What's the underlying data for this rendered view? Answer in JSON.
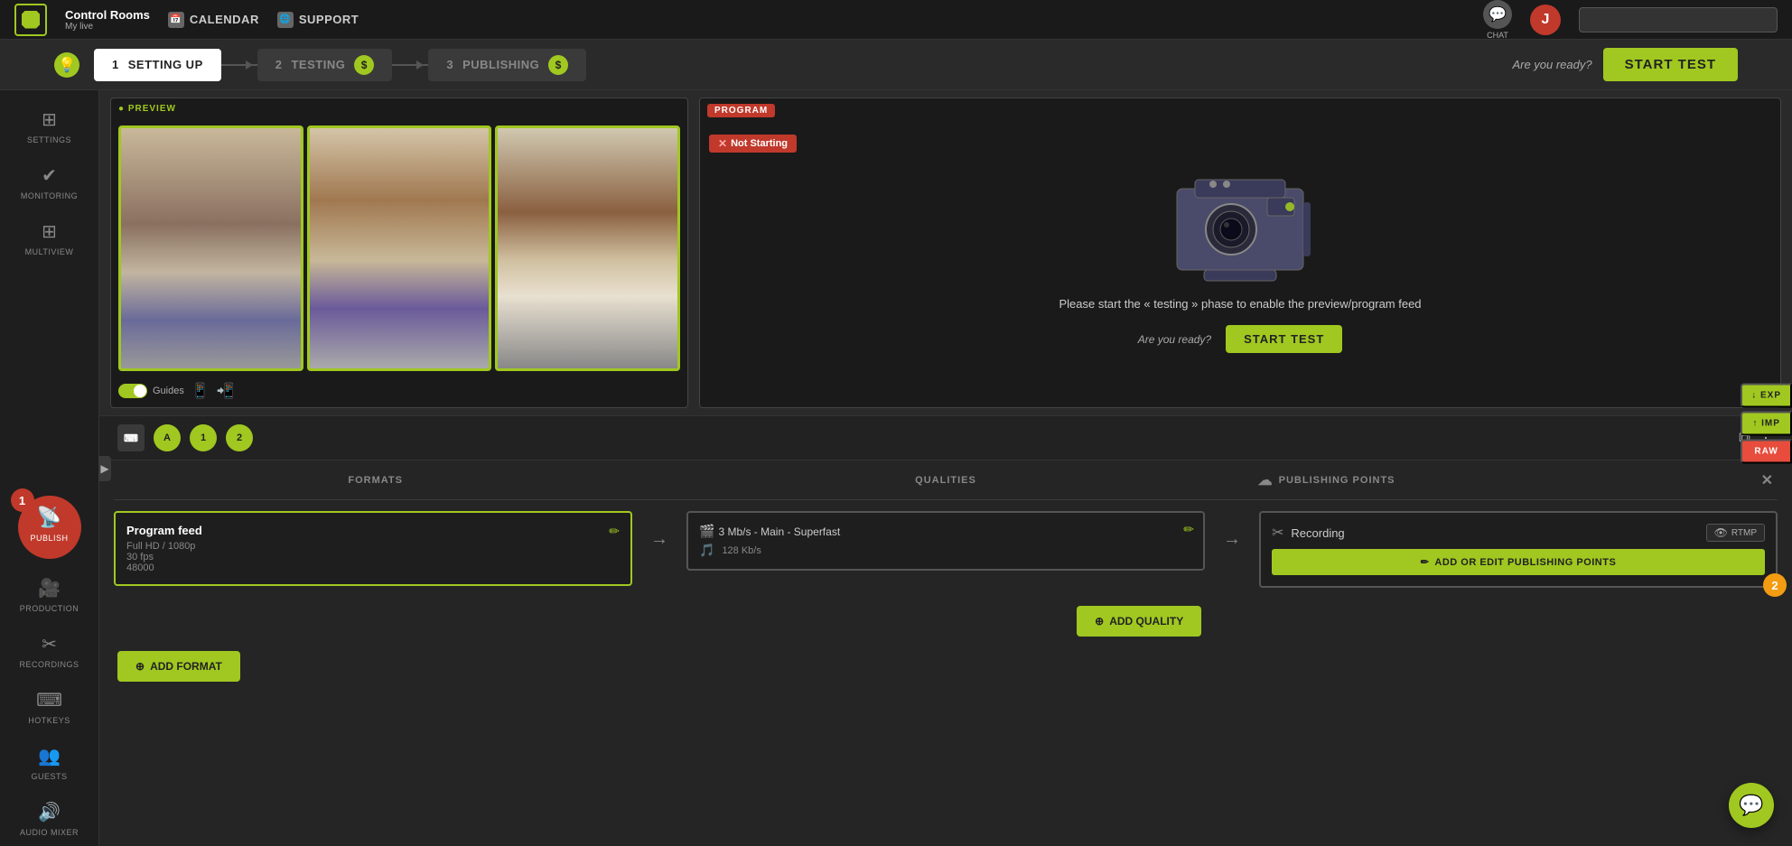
{
  "nav": {
    "logo_label": "Control Rooms",
    "sub_label": "My live",
    "calendar_label": "CALENDAR",
    "support_label": "SUPPORT",
    "chat_label": "CHAT",
    "user_initial": "J"
  },
  "progress": {
    "hint_icon": "💡",
    "step1_num": "1",
    "step1_label": "SETTING UP",
    "step2_num": "2",
    "step2_label": "TESTING",
    "step3_num": "3",
    "step3_label": "PUBLISHING",
    "ready_label": "Are you ready?",
    "start_test_label": "START TEST"
  },
  "preview": {
    "label": "● PREVIEW",
    "guides_label": "Guides"
  },
  "program": {
    "label": "PROGRAM",
    "not_starting_label": "Not Starting",
    "message": "Please start the « testing » phase to enable the preview/program feed",
    "ready_label": "Are you ready?",
    "start_test_label": "START Test"
  },
  "toolbar": {
    "btn_keyboard": "⌨",
    "btn_a": "A",
    "btn_1": "1",
    "btn_2": "2"
  },
  "publish": {
    "formats_header": "FORMATS",
    "qualities_header": "QUALITIES",
    "publishing_points_header": "PUBLISHING POINTS",
    "format_title": "Program feed",
    "format_sub1": "Full HD / 1080p",
    "format_sub2": "30 fps",
    "format_sub3": "48000",
    "quality_video": "3 Mb/s  -  Main  -  Superfast",
    "quality_audio": "128 Kb/s",
    "recording_label": "Recording",
    "rtmp_label": "RTMP",
    "add_publishing_label": "ADD OR EDIT PUBLISHING POINTS",
    "add_quality_label": "ADD QUALITY",
    "add_format_label": "ADD FORMAT"
  },
  "sidebar": {
    "settings_label": "SETTINGS",
    "monitoring_label": "MONITORING",
    "multiview_label": "MULTIVIEW",
    "publish_label": "PUBLISH",
    "production_label": "PRODUCTION",
    "recordings_label": "RECORDINGS",
    "hotkeys_label": "HOTKEYS",
    "guests_label": "GUESTS",
    "audio_mixer_label": "AUDIO MIXER"
  },
  "right_buttons": {
    "exp_label": "EXP",
    "imp_label": "IMP",
    "raw_label": "RAW"
  },
  "badges": {
    "badge1_num": "1",
    "badge2_num": "2"
  },
  "colors": {
    "accent": "#a0c820",
    "danger": "#c0392b",
    "dark": "#1a1a1a",
    "bg": "#2a2a2a"
  }
}
